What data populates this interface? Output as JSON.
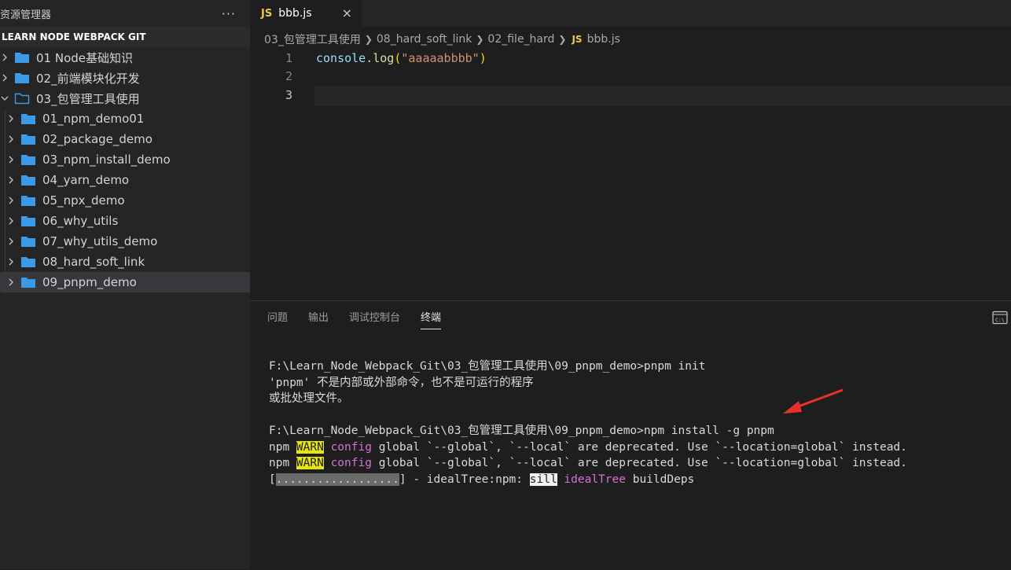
{
  "sidebar": {
    "title": "资源管理器",
    "more": "···",
    "section": "LEARN NODE WEBPACK GIT",
    "items": [
      {
        "label": "01 Node基础知识"
      },
      {
        "label": "02_前端模块化开发"
      },
      {
        "label": "03_包管理工具使用"
      },
      {
        "label": "01_npm_demo01"
      },
      {
        "label": "02_package_demo"
      },
      {
        "label": "03_npm_install_demo"
      },
      {
        "label": "04_yarn_demo"
      },
      {
        "label": "05_npx_demo"
      },
      {
        "label": "06_why_utils"
      },
      {
        "label": "07_why_utils_demo"
      },
      {
        "label": "08_hard_soft_link"
      },
      {
        "label": "09_pnpm_demo"
      }
    ]
  },
  "editor": {
    "tab": {
      "badge": "JS",
      "name": "bbb.js",
      "close": "×"
    },
    "breadcrumb": [
      "03_包管理工具使用",
      "08_hard_soft_link",
      "02_file_hard",
      "bbb.js"
    ],
    "breadcrumb_badge": "JS",
    "line_numbers": [
      "1",
      "2",
      "3"
    ],
    "code": {
      "obj": "console",
      "dot": ".",
      "fn": "log",
      "open": "(",
      "str": "\"aaaaabbbb\"",
      "close": ")"
    }
  },
  "panel": {
    "tabs": [
      "问题",
      "输出",
      "调试控制台",
      "终端"
    ],
    "active_tab": "终端",
    "terminal": {
      "l1": "F:\\Learn_Node_Webpack_Git\\03_包管理工具使用\\09_pnpm_demo>pnpm init",
      "l2": "'pnpm' 不是内部或外部命令，也不是可运行的程序",
      "l3": "或批处理文件。",
      "l5": "F:\\Learn_Node_Webpack_Git\\03_包管理工具使用\\09_pnpm_demo>npm install -g pnpm",
      "warn_prefix": "npm ",
      "warn": "WARN",
      "config": "config",
      "warn_rest": " global `--global`, `--local` are deprecated. Use `--location=global` instead.",
      "progress_open": "[",
      "progress_bar": "..................",
      "progress_mid": "] - idealTree:npm: ",
      "sill": "sill",
      "idealTree": "idealTree",
      "buildDeps": " buildDeps"
    }
  },
  "colors": {
    "accent": "#e5e510",
    "arrow": "#e8302a",
    "js": "#e8c94a"
  }
}
